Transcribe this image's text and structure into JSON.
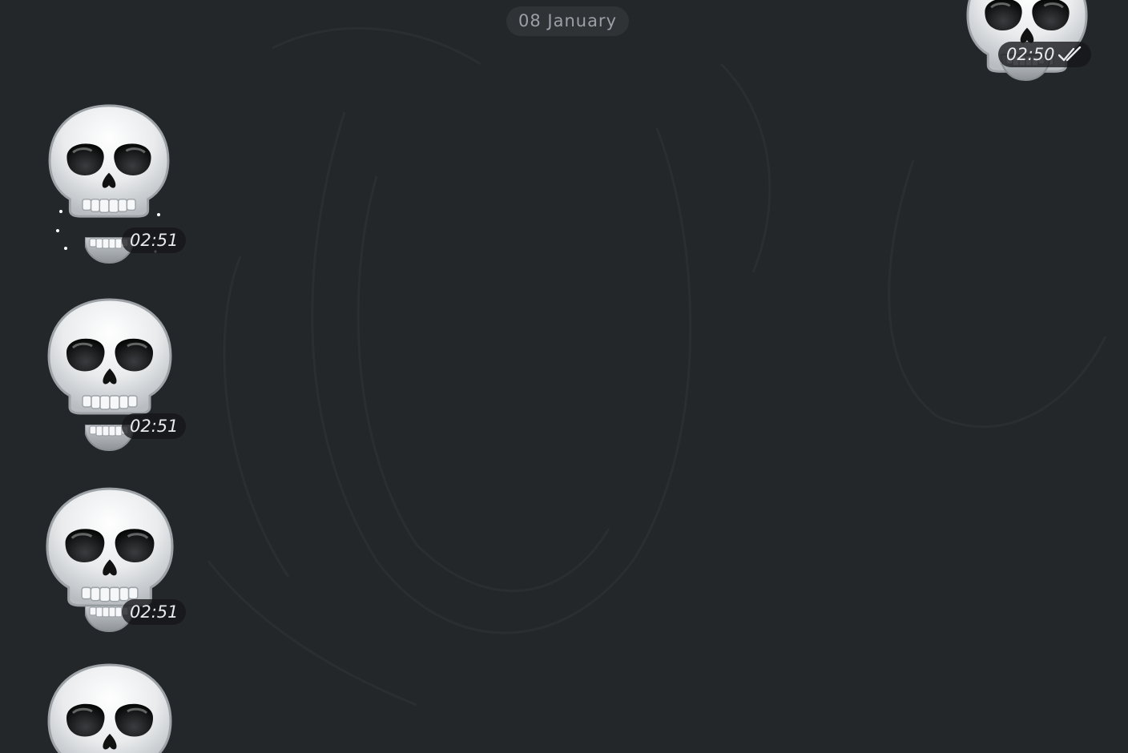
{
  "chat": {
    "date_separator": "08 January",
    "messages": [
      {
        "direction": "outgoing",
        "sticker": "skull-icon",
        "time": "02:50",
        "status": "read"
      },
      {
        "direction": "incoming",
        "sticker": "skull-icon",
        "time": "02:51"
      },
      {
        "direction": "incoming",
        "sticker": "skull-icon",
        "time": "02:51"
      },
      {
        "direction": "incoming",
        "sticker": "skull-icon",
        "time": "02:51"
      },
      {
        "direction": "incoming",
        "sticker": "skull-icon",
        "time": ""
      }
    ]
  },
  "colors": {
    "background": "#24272a",
    "time_pill": "#141618",
    "text": "#e8eaed",
    "date_text": "#9aa0a6"
  }
}
